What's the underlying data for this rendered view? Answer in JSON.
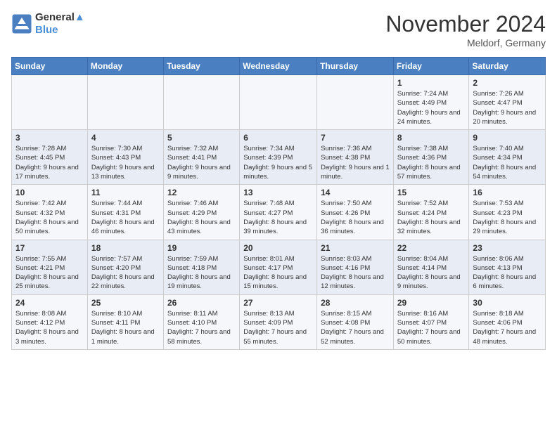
{
  "header": {
    "logo_line1": "General",
    "logo_line2": "Blue",
    "month": "November 2024",
    "location": "Meldorf, Germany"
  },
  "days_of_week": [
    "Sunday",
    "Monday",
    "Tuesday",
    "Wednesday",
    "Thursday",
    "Friday",
    "Saturday"
  ],
  "weeks": [
    [
      {
        "day": "",
        "info": ""
      },
      {
        "day": "",
        "info": ""
      },
      {
        "day": "",
        "info": ""
      },
      {
        "day": "",
        "info": ""
      },
      {
        "day": "",
        "info": ""
      },
      {
        "day": "1",
        "info": "Sunrise: 7:24 AM\nSunset: 4:49 PM\nDaylight: 9 hours and 24 minutes."
      },
      {
        "day": "2",
        "info": "Sunrise: 7:26 AM\nSunset: 4:47 PM\nDaylight: 9 hours and 20 minutes."
      }
    ],
    [
      {
        "day": "3",
        "info": "Sunrise: 7:28 AM\nSunset: 4:45 PM\nDaylight: 9 hours and 17 minutes."
      },
      {
        "day": "4",
        "info": "Sunrise: 7:30 AM\nSunset: 4:43 PM\nDaylight: 9 hours and 13 minutes."
      },
      {
        "day": "5",
        "info": "Sunrise: 7:32 AM\nSunset: 4:41 PM\nDaylight: 9 hours and 9 minutes."
      },
      {
        "day": "6",
        "info": "Sunrise: 7:34 AM\nSunset: 4:39 PM\nDaylight: 9 hours and 5 minutes."
      },
      {
        "day": "7",
        "info": "Sunrise: 7:36 AM\nSunset: 4:38 PM\nDaylight: 9 hours and 1 minute."
      },
      {
        "day": "8",
        "info": "Sunrise: 7:38 AM\nSunset: 4:36 PM\nDaylight: 8 hours and 57 minutes."
      },
      {
        "day": "9",
        "info": "Sunrise: 7:40 AM\nSunset: 4:34 PM\nDaylight: 8 hours and 54 minutes."
      }
    ],
    [
      {
        "day": "10",
        "info": "Sunrise: 7:42 AM\nSunset: 4:32 PM\nDaylight: 8 hours and 50 minutes."
      },
      {
        "day": "11",
        "info": "Sunrise: 7:44 AM\nSunset: 4:31 PM\nDaylight: 8 hours and 46 minutes."
      },
      {
        "day": "12",
        "info": "Sunrise: 7:46 AM\nSunset: 4:29 PM\nDaylight: 8 hours and 43 minutes."
      },
      {
        "day": "13",
        "info": "Sunrise: 7:48 AM\nSunset: 4:27 PM\nDaylight: 8 hours and 39 minutes."
      },
      {
        "day": "14",
        "info": "Sunrise: 7:50 AM\nSunset: 4:26 PM\nDaylight: 8 hours and 36 minutes."
      },
      {
        "day": "15",
        "info": "Sunrise: 7:52 AM\nSunset: 4:24 PM\nDaylight: 8 hours and 32 minutes."
      },
      {
        "day": "16",
        "info": "Sunrise: 7:53 AM\nSunset: 4:23 PM\nDaylight: 8 hours and 29 minutes."
      }
    ],
    [
      {
        "day": "17",
        "info": "Sunrise: 7:55 AM\nSunset: 4:21 PM\nDaylight: 8 hours and 25 minutes."
      },
      {
        "day": "18",
        "info": "Sunrise: 7:57 AM\nSunset: 4:20 PM\nDaylight: 8 hours and 22 minutes."
      },
      {
        "day": "19",
        "info": "Sunrise: 7:59 AM\nSunset: 4:18 PM\nDaylight: 8 hours and 19 minutes."
      },
      {
        "day": "20",
        "info": "Sunrise: 8:01 AM\nSunset: 4:17 PM\nDaylight: 8 hours and 15 minutes."
      },
      {
        "day": "21",
        "info": "Sunrise: 8:03 AM\nSunset: 4:16 PM\nDaylight: 8 hours and 12 minutes."
      },
      {
        "day": "22",
        "info": "Sunrise: 8:04 AM\nSunset: 4:14 PM\nDaylight: 8 hours and 9 minutes."
      },
      {
        "day": "23",
        "info": "Sunrise: 8:06 AM\nSunset: 4:13 PM\nDaylight: 8 hours and 6 minutes."
      }
    ],
    [
      {
        "day": "24",
        "info": "Sunrise: 8:08 AM\nSunset: 4:12 PM\nDaylight: 8 hours and 3 minutes."
      },
      {
        "day": "25",
        "info": "Sunrise: 8:10 AM\nSunset: 4:11 PM\nDaylight: 8 hours and 1 minute."
      },
      {
        "day": "26",
        "info": "Sunrise: 8:11 AM\nSunset: 4:10 PM\nDaylight: 7 hours and 58 minutes."
      },
      {
        "day": "27",
        "info": "Sunrise: 8:13 AM\nSunset: 4:09 PM\nDaylight: 7 hours and 55 minutes."
      },
      {
        "day": "28",
        "info": "Sunrise: 8:15 AM\nSunset: 4:08 PM\nDaylight: 7 hours and 52 minutes."
      },
      {
        "day": "29",
        "info": "Sunrise: 8:16 AM\nSunset: 4:07 PM\nDaylight: 7 hours and 50 minutes."
      },
      {
        "day": "30",
        "info": "Sunrise: 8:18 AM\nSunset: 4:06 PM\nDaylight: 7 hours and 48 minutes."
      }
    ]
  ]
}
